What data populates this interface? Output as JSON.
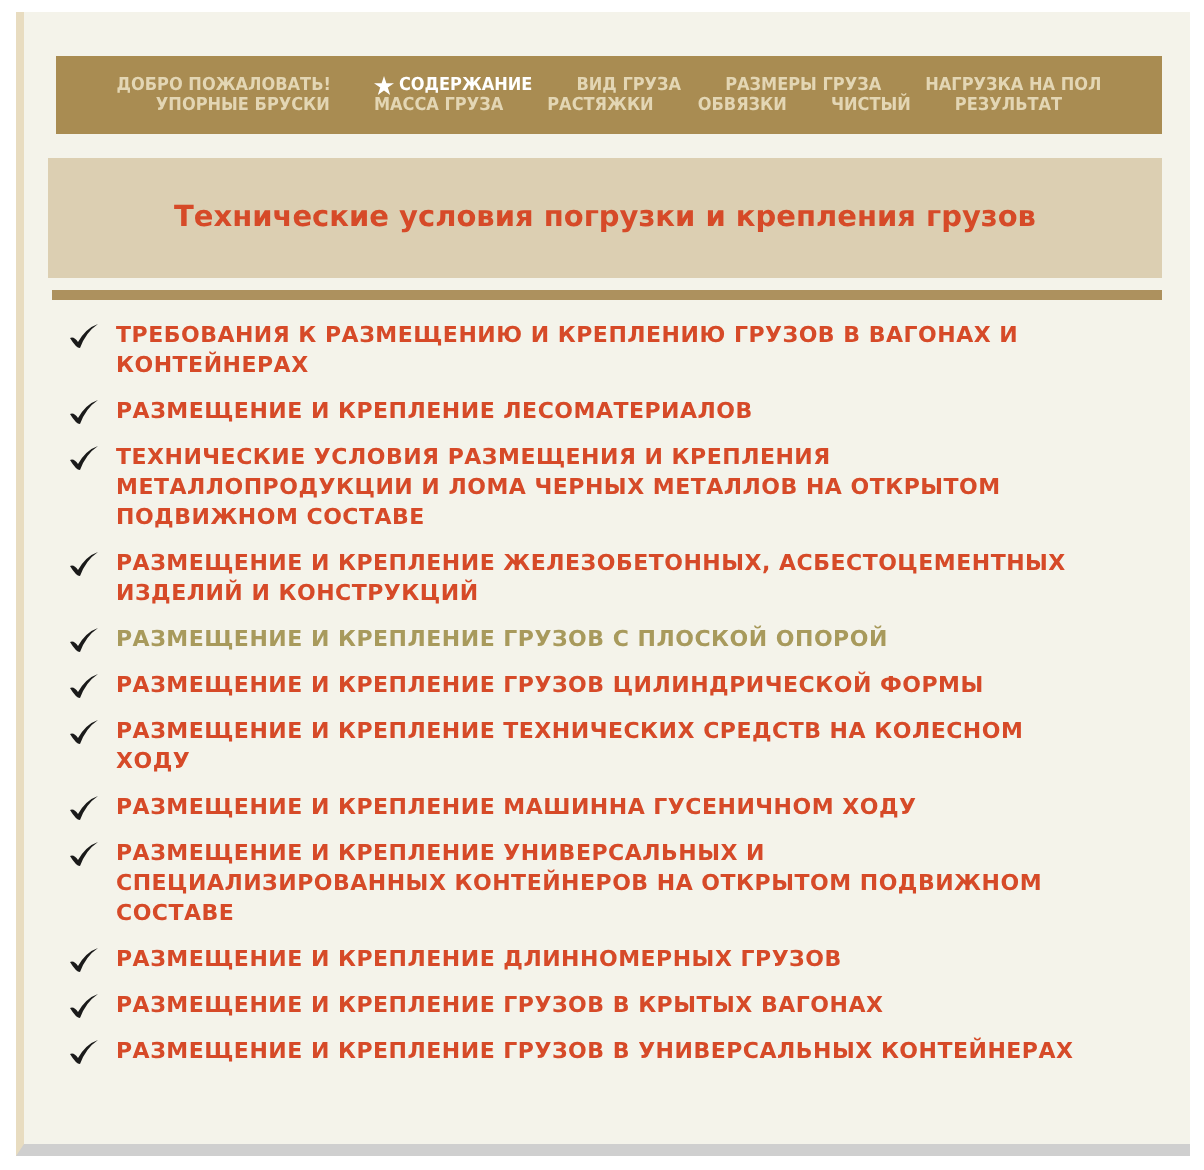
{
  "nav": [
    {
      "label": "ДОБРО ПОЖАЛОВАТЬ!",
      "selected": false
    },
    {
      "label": "СОДЕРЖАНИЕ",
      "selected": true
    },
    {
      "label": "ВИД ГРУЗА",
      "selected": false
    },
    {
      "label": "РАЗМЕРЫ ГРУЗА",
      "selected": false
    },
    {
      "label": "НАГРУЗКА НА ПОЛ",
      "selected": false
    },
    {
      "label": "УПОРНЫЕ БРУСКИ",
      "selected": false
    },
    {
      "label": "МАССА ГРУЗА",
      "selected": false
    },
    {
      "label": "РАСТЯЖКИ",
      "selected": false
    },
    {
      "label": "ОБВЯЗКИ",
      "selected": false
    },
    {
      "label": "ЧИСТЫЙ",
      "selected": false
    },
    {
      "label": "РЕЗУЛЬТАТ",
      "selected": false
    }
  ],
  "heading": "Технические условия погрузки и крепления грузов",
  "items": [
    {
      "label": "ТРЕБОВАНИЯ К РАЗМЕЩЕНИЮ И КРЕПЛЕНИЮ ГРУЗОВ В ВАГОНАХ И КОНТЕЙНЕРАХ",
      "hovered": false
    },
    {
      "label": "РАЗМЕЩЕНИЕ И КРЕПЛЕНИЕ ЛЕСОМАТЕРИАЛОВ",
      "hovered": false
    },
    {
      "label": "ТЕХНИЧЕСКИЕ УСЛОВИЯ РАЗМЕЩЕНИЯ И КРЕПЛЕНИЯ МЕТАЛЛОПРОДУКЦИИ И ЛОМА ЧЕРНЫХ МЕТАЛЛОВ НА ОТКРЫТОМ ПОДВИЖНОМ СОСТАВЕ",
      "hovered": false
    },
    {
      "label": "РАЗМЕЩЕНИЕ И КРЕПЛЕНИЕ ЖЕЛЕЗОБЕТОННЫХ, АСБЕСТОЦЕМЕНТНЫХ ИЗДЕЛИЙ И КОНСТРУКЦИЙ",
      "hovered": false
    },
    {
      "label": "РАЗМЕЩЕНИЕ И КРЕПЛЕНИЕ ГРУЗОВ С ПЛОСКОЙ ОПОРОЙ",
      "hovered": true
    },
    {
      "label": "РАЗМЕЩЕНИЕ И КРЕПЛЕНИЕ ГРУЗОВ ЦИЛИНДРИЧЕСКОЙ ФОРМЫ",
      "hovered": false
    },
    {
      "label": "РАЗМЕЩЕНИЕ И КРЕПЛЕНИЕ ТЕХНИЧЕСКИХ СРЕДСТВ НА КОЛЕСНОМ ХОДУ",
      "hovered": false
    },
    {
      "label": "РАЗМЕЩЕНИЕ И КРЕПЛЕНИЕ МАШИННА ГУСЕНИЧНОМ ХОДУ",
      "hovered": false
    },
    {
      "label": "РАЗМЕЩЕНИЕ И КРЕПЛЕНИЕ УНИВЕРСАЛЬНЫХ И СПЕЦИАЛИЗИРОВАННЫХ КОНТЕЙНЕРОВ НА ОТКРЫТОМ ПОДВИЖНОМ СОСТАВЕ",
      "hovered": false
    },
    {
      "label": "РАЗМЕЩЕНИЕ И КРЕПЛЕНИЕ ДЛИННОМЕРНЫХ ГРУЗОВ",
      "hovered": false
    },
    {
      "label": "РАЗМЕЩЕНИЕ И КРЕПЛЕНИЕ ГРУЗОВ В КРЫТЫХ ВАГОНАХ",
      "hovered": false
    },
    {
      "label": "РАЗМЕЩЕНИЕ И КРЕПЛЕНИЕ ГРУЗОВ В УНИВЕРСАЛЬНЫХ КОНТЕЙНЕРАХ",
      "hovered": false
    }
  ]
}
